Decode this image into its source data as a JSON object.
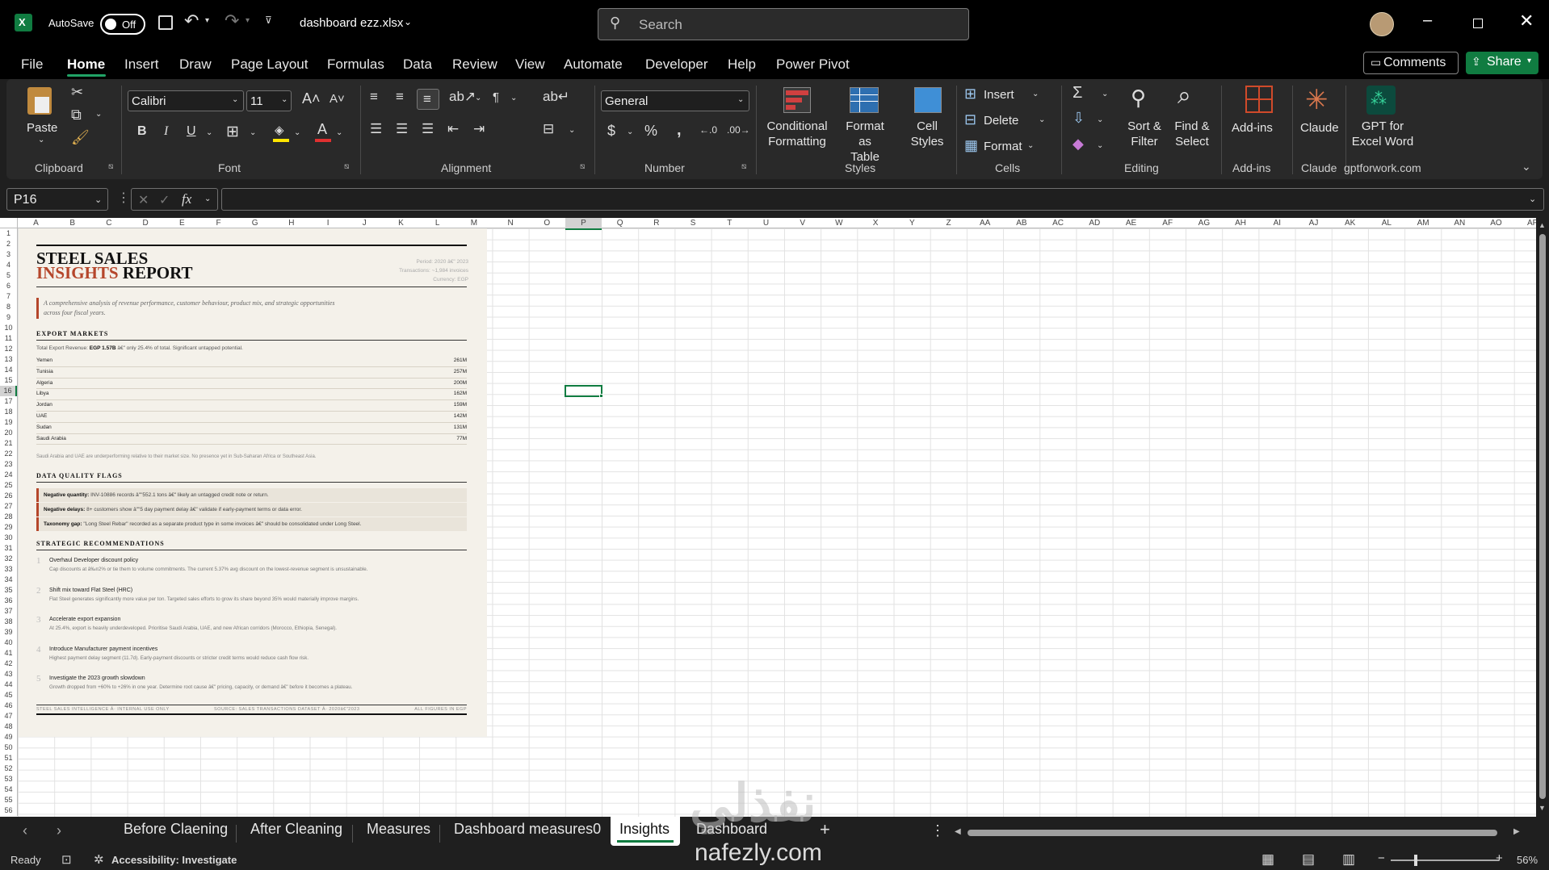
{
  "titlebar": {
    "autosave_label": "AutoSave",
    "autosave_state": "Off",
    "filename": "dashboard ezz.xlsx",
    "search_placeholder": "Search"
  },
  "menu": [
    "File",
    "Home",
    "Insert",
    "Draw",
    "Page Layout",
    "Formulas",
    "Data",
    "Review",
    "View",
    "Automate",
    "Developer",
    "Help",
    "Power Pivot"
  ],
  "menu_active": "Home",
  "comments_label": "Comments",
  "share_label": "Share",
  "ribbon": {
    "paste": "Paste",
    "font_name": "Calibri",
    "font_size": "11",
    "number_format": "General",
    "conditional_formatting": [
      "Conditional",
      "Formatting"
    ],
    "format_as_table": [
      "Format as",
      "Table"
    ],
    "cell_styles": [
      "Cell",
      "Styles"
    ],
    "insert": "Insert",
    "delete": "Delete",
    "format": "Format",
    "sort_filter": [
      "Sort &",
      "Filter"
    ],
    "find_select": [
      "Find &",
      "Select"
    ],
    "addins": "Add-ins",
    "claude": "Claude",
    "gpt": [
      "GPT for",
      "Excel Word"
    ],
    "groups": {
      "clipboard": "Clipboard",
      "font": "Font",
      "alignment": "Alignment",
      "number": "Number",
      "styles": "Styles",
      "cells": "Cells",
      "editing": "Editing",
      "addins": "Add-ins",
      "claude": "Claude",
      "gpt": "gptforwork.com"
    }
  },
  "namebox": "P16",
  "fx": "fx",
  "columns": [
    "A",
    "B",
    "C",
    "D",
    "E",
    "F",
    "G",
    "H",
    "I",
    "J",
    "K",
    "L",
    "M",
    "N",
    "O",
    "P",
    "Q",
    "R",
    "S",
    "T",
    "U",
    "V",
    "W",
    "X",
    "Y",
    "Z",
    "AA",
    "AB",
    "AC",
    "AD",
    "AE",
    "AF",
    "AG",
    "AH",
    "AI",
    "AJ",
    "AK",
    "AL",
    "AM",
    "AN",
    "AO",
    "AP"
  ],
  "selected_column": "P",
  "selected_row": "16",
  "report": {
    "title_line1": "STEEL SALES",
    "title_line2_accent": "INSIGHTS",
    "title_line2_rest": " REPORT",
    "meta": [
      "Period: 2020 â€\" 2023",
      "Transactions: ~1,984 invoices",
      "Currency: EGP"
    ],
    "intro": [
      "A comprehensive analysis of revenue performance, customer behaviour, product mix, and strategic opportunities",
      "across four fiscal years."
    ],
    "export_heading": "EXPORT MARKETS",
    "export_total_prefix": "Total Export Revenue: ",
    "export_total_value": "EGP 1.57B",
    "export_total_suffix": " â€\" only 25.4% of total. Significant untapped potential.",
    "markets": [
      {
        "name": "Yemen",
        "value": "261M"
      },
      {
        "name": "Tunisia",
        "value": "257M"
      },
      {
        "name": "Algeria",
        "value": "200M"
      },
      {
        "name": "Libya",
        "value": "162M"
      },
      {
        "name": "Jordan",
        "value": "159M"
      },
      {
        "name": "UAE",
        "value": "142M"
      },
      {
        "name": "Sudan",
        "value": "131M"
      },
      {
        "name": "Saudi Arabia",
        "value": "77M"
      }
    ],
    "export_note": "Saudi Arabia and UAE are underperforming relative to their market size. No presence yet in Sub-Saharan Africa or Southeast Asia.",
    "flags_heading": "DATA QUALITY FLAGS",
    "flags": [
      {
        "label": "Negative quantity:",
        "text": " INV-10886 records â\"\"552.1 tons â€\" likely an untagged credit note or return."
      },
      {
        "label": "Negative delays:",
        "text": " 8+ customers show â\"\"5 day payment delay â€\" validate if early-payment terms or data error."
      },
      {
        "label": "Taxonomy gap:",
        "text": " \"Long Steel Rebar\" recorded as a separate product type in some invoices â€\" should be consolidated under Long Steel."
      }
    ],
    "recs_heading": "STRATEGIC RECOMMENDATIONS",
    "recs": [
      {
        "n": "1",
        "title": "Overhaul Developer discount policy",
        "desc": "Cap discounts at â‰¤2% or tie them to volume commitments. The current 5.37% avg discount on the lowest-revenue segment is unsustainable."
      },
      {
        "n": "2",
        "title": "Shift mix toward Flat Steel (HRC)",
        "desc": "Flat Steel generates significantly more value per ton. Targeted sales efforts to grow its share beyond 35% would materially improve margins."
      },
      {
        "n": "3",
        "title": "Accelerate export expansion",
        "desc": "At 25.4%, export is heavily underdeveloped. Prioritise Saudi Arabia, UAE, and new African corridors (Morocco, Ethiopia, Senegal)."
      },
      {
        "n": "4",
        "title": "Introduce Manufacturer payment incentives",
        "desc": "Highest payment delay segment (11.7d). Early-payment discounts or stricter credit terms would reduce cash flow risk."
      },
      {
        "n": "5",
        "title": "Investigate the 2023 growth slowdown",
        "desc": "Growth dropped from +60% to +26% in one year. Determine root cause â€\" pricing, capacity, or demand â€\" before it becomes a plateau."
      }
    ],
    "footer_left": "STEEL SALES INTELLIGENCE Â· INTERNAL USE ONLY",
    "footer_mid": "SOURCE: SALES TRANSACTIONS DATASET Â· 2020â€\"2023",
    "footer_right": "ALL FIGURES IN EGP"
  },
  "sheet_tabs": [
    "Before Claening",
    "After Cleaning",
    "Measures",
    "Dashboard measures0",
    "Insights",
    "Dashboard"
  ],
  "active_tab": "Insights",
  "status": {
    "ready": "Ready",
    "accessibility": "Accessibility: Investigate",
    "zoom": "56%"
  },
  "watermark": {
    "arabic": "نفذلي",
    "latin": "nafezly.com"
  },
  "colors": {
    "accent": "#b5462b",
    "share": "#107c41",
    "excel_green": "#21a366"
  }
}
